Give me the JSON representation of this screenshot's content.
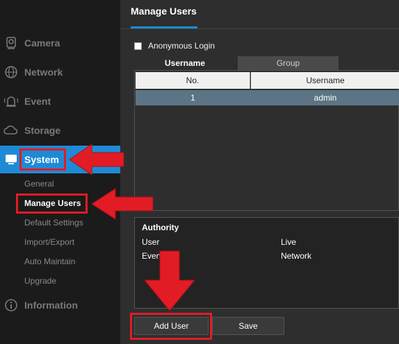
{
  "sidebar": {
    "items": [
      {
        "label": "Camera",
        "icon": "camera-icon"
      },
      {
        "label": "Network",
        "icon": "network-globe-icon"
      },
      {
        "label": "Event",
        "icon": "alarm-bell-icon"
      },
      {
        "label": "Storage",
        "icon": "cloud-storage-icon"
      },
      {
        "label": "System",
        "icon": "monitor-icon",
        "active": true
      },
      {
        "label": "Information",
        "icon": "info-icon"
      }
    ],
    "system_subitems": [
      {
        "label": "General"
      },
      {
        "label": "Manage Users",
        "active": true
      },
      {
        "label": "Default Settings"
      },
      {
        "label": "Import/Export"
      },
      {
        "label": "Auto Maintain"
      },
      {
        "label": "Upgrade"
      }
    ]
  },
  "main": {
    "title": "Manage Users",
    "anonymous_login": {
      "label": "Anonymous Login",
      "checked": false
    },
    "tabs": [
      {
        "label": "Username",
        "active": true
      },
      {
        "label": "Group",
        "active": false
      }
    ],
    "table": {
      "headers": [
        "No.",
        "Username"
      ],
      "rows": [
        {
          "no": "1",
          "username": "admin"
        }
      ]
    },
    "authority": {
      "title": "Authority",
      "items": [
        "User",
        "Live",
        "Even",
        "Network"
      ]
    },
    "buttons": {
      "add_user": "Add User",
      "save": "Save"
    }
  },
  "colors": {
    "accent": "#1e8ad6",
    "callout": "#e21c24",
    "selected_row": "#5c7485"
  }
}
